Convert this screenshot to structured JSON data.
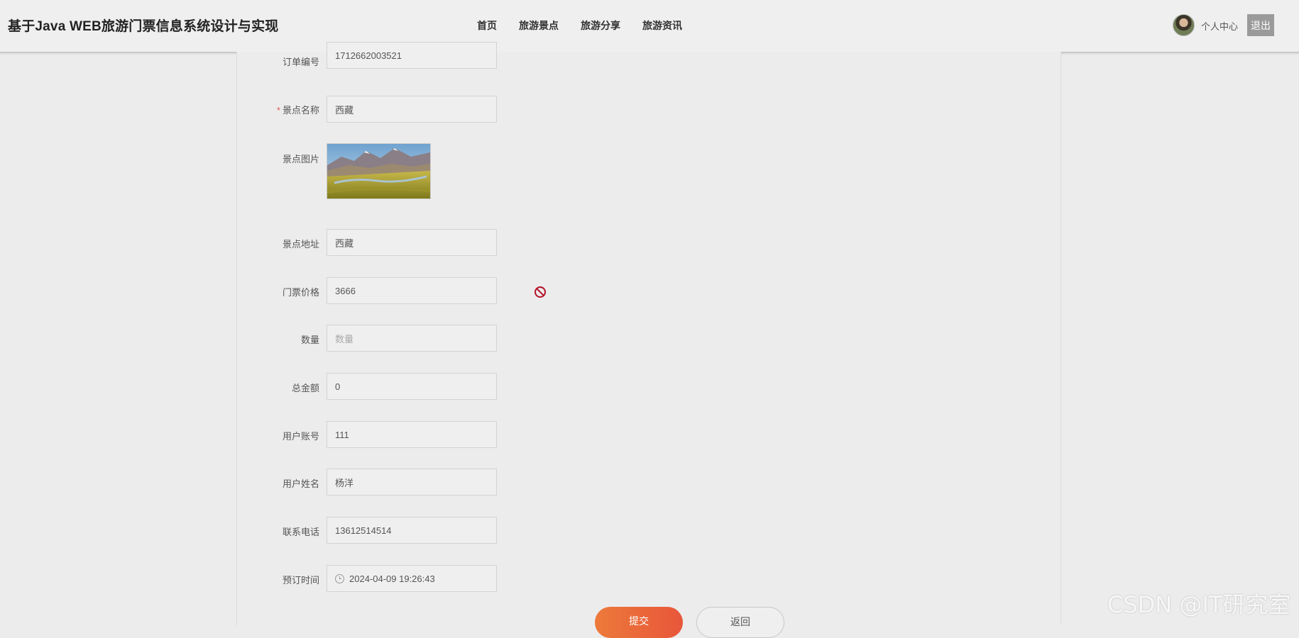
{
  "header": {
    "title": "基于Java WEB旅游门票信息系统设计与实现",
    "nav": [
      "首页",
      "旅游景点",
      "旅游分享",
      "旅游资讯"
    ],
    "personal_center": "个人中心",
    "logout": "退出"
  },
  "form": {
    "order_no": {
      "label": "订单编号",
      "value": "1712662003521"
    },
    "spot_name": {
      "label": "景点名称",
      "value": "西藏",
      "required_mark": "*"
    },
    "spot_image": {
      "label": "景点图片"
    },
    "spot_address": {
      "label": "景点地址",
      "value": "西藏"
    },
    "ticket_price": {
      "label": "门票价格",
      "value": "3666"
    },
    "quantity": {
      "label": "数量",
      "placeholder": "数量"
    },
    "total_amount": {
      "label": "总金额",
      "value": "0"
    },
    "user_account": {
      "label": "用户账号",
      "value": "111"
    },
    "user_name": {
      "label": "用户姓名",
      "value": "杨洋"
    },
    "phone": {
      "label": "联系电话",
      "value": "13612514514"
    },
    "booking_time": {
      "label": "预订时间",
      "value": "2024-04-09 19:26:43"
    }
  },
  "actions": {
    "submit": "提交",
    "back": "返回"
  },
  "watermark": "CSDN @IT研究室",
  "colors": {
    "submit_start": "#ec7a3a",
    "submit_end": "#e8563a",
    "required": "#e05a5a",
    "block_icon": "#b5122a"
  }
}
